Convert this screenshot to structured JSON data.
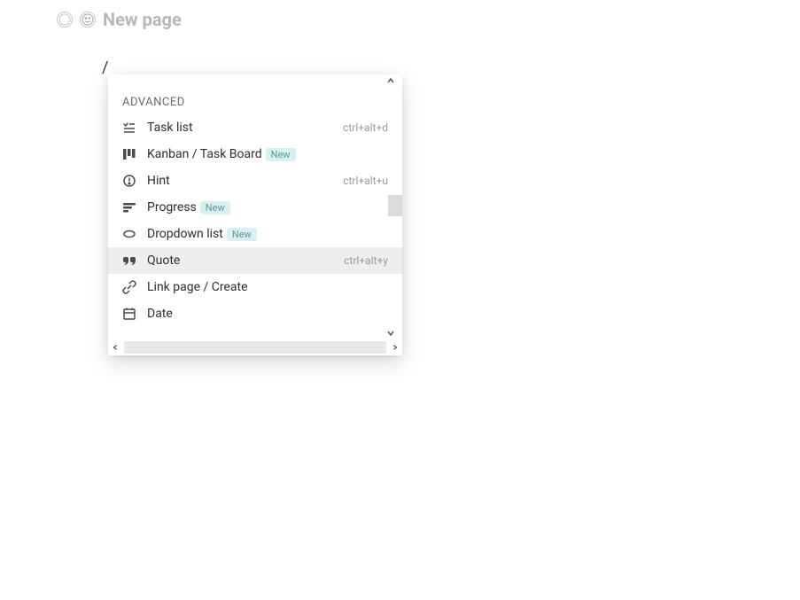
{
  "header": {
    "title": "New page"
  },
  "editor": {
    "slash_command": "/"
  },
  "menu": {
    "section_label": "ADVANCED",
    "new_badge": "New",
    "items": [
      {
        "icon": "task-list",
        "label": "Task list",
        "shortcut": "ctrl+alt+d",
        "new": false,
        "selected": false
      },
      {
        "icon": "kanban",
        "label": "Kanban / Task Board",
        "shortcut": "",
        "new": true,
        "selected": false
      },
      {
        "icon": "hint",
        "label": "Hint",
        "shortcut": "ctrl+alt+u",
        "new": false,
        "selected": false
      },
      {
        "icon": "progress",
        "label": "Progress",
        "shortcut": "",
        "new": true,
        "selected": false
      },
      {
        "icon": "dropdown",
        "label": "Dropdown list",
        "shortcut": "",
        "new": true,
        "selected": false
      },
      {
        "icon": "quote",
        "label": "Quote",
        "shortcut": "ctrl+alt+y",
        "new": false,
        "selected": true
      },
      {
        "icon": "link",
        "label": "Link page / Create",
        "shortcut": "",
        "new": false,
        "selected": false
      },
      {
        "icon": "date",
        "label": "Date",
        "shortcut": "",
        "new": false,
        "selected": false
      }
    ]
  }
}
